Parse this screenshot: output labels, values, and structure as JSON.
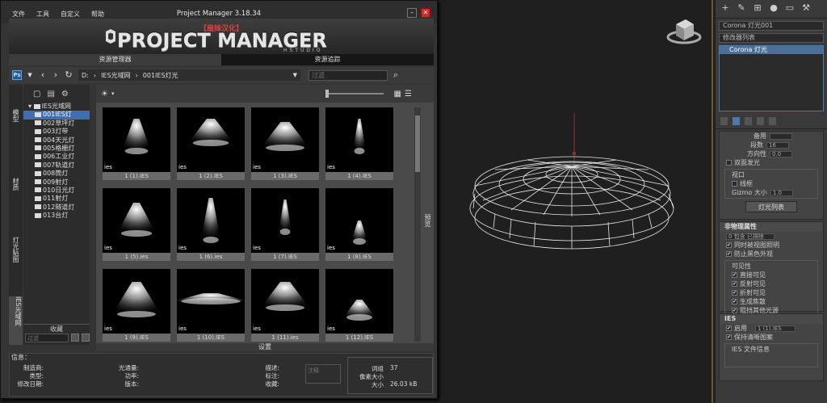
{
  "pm": {
    "menu": [
      "文件",
      "工具",
      "自定义",
      "帮助"
    ],
    "window_title": "Project Manager 3.18.34",
    "banner_sub": "【扇妹汉化】",
    "logo": "PROJECT MANAGER",
    "logo_sub": "HSTUDIO",
    "tabs": [
      "资源管理器",
      "资源追踪"
    ],
    "toolbar": {
      "ps": "Ps",
      "path": [
        "D:",
        "IES光域网",
        "001IES灯光"
      ],
      "filter_placeholder": "过滤"
    },
    "side_tabs": [
      "模型",
      "材质",
      "灯光贴图",
      "IES光域网"
    ],
    "tree": {
      "root": "IES光域网",
      "items": [
        "001IES灯",
        "002草坪灯",
        "003灯带",
        "004天光灯",
        "005格栅灯",
        "006工业灯",
        "007轨道灯",
        "008筒灯",
        "009射灯",
        "010日光灯",
        "011射灯",
        "012隧道灯",
        "013台灯"
      ],
      "header": "收藏",
      "filter": "过滤"
    },
    "thumbs": [
      {
        "label": "1 (1).IES",
        "tag": "ies",
        "shape": 0
      },
      {
        "label": "1 (2).IES",
        "tag": "ies",
        "shape": 1
      },
      {
        "label": "1 (3).IES",
        "tag": "ies",
        "shape": 2
      },
      {
        "label": "1 (4).IES",
        "tag": "ies",
        "shape": 3
      },
      {
        "label": "1 (5).ies",
        "tag": "ies",
        "shape": 4
      },
      {
        "label": "1 (6).ies",
        "tag": "ies",
        "shape": 5
      },
      {
        "label": "1 (7).IES",
        "tag": "ies",
        "shape": 3
      },
      {
        "label": "1 (8).IES",
        "tag": "ies",
        "shape": 6
      },
      {
        "label": "1 (9).IES",
        "tag": "ies",
        "shape": 7
      },
      {
        "label": "1 (10).IES",
        "tag": "ies",
        "shape": 8
      },
      {
        "label": "1 (11).ies",
        "tag": "ies",
        "shape": 9
      },
      {
        "label": "1 (12).IES",
        "tag": "ies",
        "shape": 10
      }
    ],
    "right_tab": "预览",
    "bottom_label": "设置",
    "info": {
      "title": "信息：",
      "left_labels": [
        "制造商:",
        "类型:",
        "修改日期:"
      ],
      "mid_labels": [
        "光通量:",
        "功率:",
        "版本:"
      ],
      "mid2_labels": [
        "描述:",
        "标注:",
        "收藏:"
      ],
      "notes_placeholder": "注释",
      "right_labels": [
        "词组",
        "像素大小",
        "大小"
      ],
      "right_values": [
        "37",
        "",
        "26.03 kB"
      ]
    }
  },
  "cmd": {
    "object_name": "Corona 灯光001",
    "modifier_list": "修改器列表",
    "stack_item": "Corona 灯光",
    "params": {
      "rows": [
        {
          "label": "备用",
          "value": ""
        },
        {
          "label": "段数",
          "value": "16"
        },
        {
          "label": "方向性",
          "value": "0.0"
        }
      ],
      "two_sided": "双面发光",
      "viewport": "视口",
      "wire": "线框",
      "gizmo": "Gizmo 大小",
      "gizmo_val": "1.0",
      "light_list": "灯光列表"
    },
    "nonphys": {
      "title": "非物理属性",
      "excl": "0 包含 已排除",
      "items": [
        "同时被视图照明",
        "防止黑色外观"
      ],
      "visibility": "可见性",
      "vis_items": [
        "直接可见",
        "反射可见",
        "折射可见",
        "生成焦散",
        "阻挡其他光源"
      ]
    },
    "ies": {
      "title": "IES",
      "enable": "启用",
      "file": "1 (1).IES",
      "keep": "保持清晰图案",
      "file_info": "IES 文件信息"
    }
  }
}
